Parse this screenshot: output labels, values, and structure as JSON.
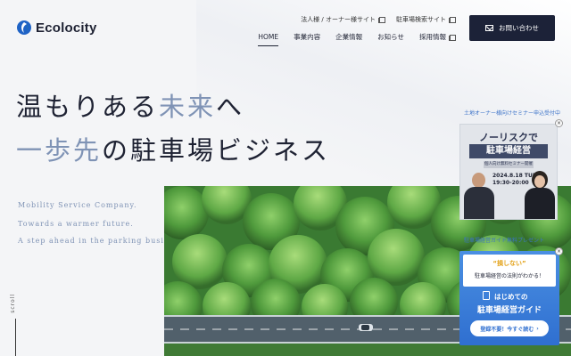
{
  "brand": {
    "name": "Ecolocity"
  },
  "header": {
    "utility_links": [
      {
        "label": "法人様 / オーナー様サイト",
        "icon": "external-link-icon"
      },
      {
        "label": "駐車場検索サイト",
        "icon": "external-link-icon"
      }
    ],
    "nav": [
      {
        "label": "HOME",
        "active": true
      },
      {
        "label": "事業内容"
      },
      {
        "label": "企業情報"
      },
      {
        "label": "お知らせ"
      },
      {
        "label": "採用情報",
        "icon": "external-link-icon"
      }
    ],
    "contact_button": {
      "label": "お問い合わせ",
      "icon": "mail-icon"
    }
  },
  "hero": {
    "line1_part1": "温もりある",
    "line1_accent": "未来",
    "line1_part2": "へ",
    "line2_part1": "一歩",
    "line2_accent": "先",
    "line2_part2": "の駐車場ビジネス",
    "taglines": [
      "Mobility Service Company.",
      "Towards a warmer future.",
      "A step ahead in the parking business."
    ],
    "scroll_label": "scroll"
  },
  "seminar_banner": {
    "caption": "土地オーナー様向けセミナー申込受付中",
    "title_line1": "ノーリスクで",
    "title_line2": "駐車場経営",
    "subtitle": "個人向け無料セミナー開催",
    "date_line1": "2024.8.18 TUE.",
    "date_line2": "19:30-20:00",
    "close": "×"
  },
  "guide_banner": {
    "caption": "駐車場経営ガイド無料プレゼント",
    "quote": "“損しない”",
    "law": "駐車場経営の法則がわかる！",
    "title1": "はじめての",
    "title2": "駐車場経営ガイド",
    "cta": "登録不要！今すぐ読む",
    "close": "×"
  },
  "colors": {
    "navy": "#1c2238",
    "accent_blue_gray": "#7f93b5",
    "link_blue": "#3b72c8",
    "guide_blue": "#2f6fd0"
  }
}
